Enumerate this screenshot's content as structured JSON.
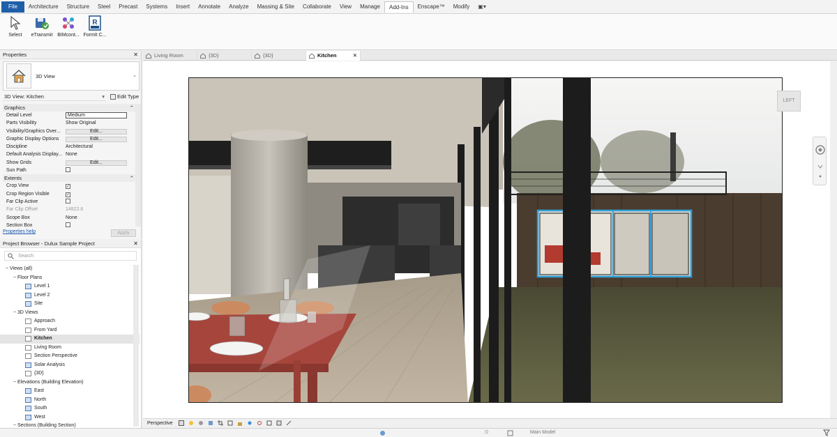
{
  "ribbon": {
    "file_tab": "File",
    "tabs": [
      "Architecture",
      "Structure",
      "Steel",
      "Precast",
      "Systems",
      "Insert",
      "Annotate",
      "Analyze",
      "Massing & Site",
      "Collaborate",
      "View",
      "Manage",
      "Add-Ins",
      "Enscape™",
      "Modify"
    ],
    "active_tab": "Add-Ins",
    "buttons": [
      {
        "label": "Select",
        "icon": "cursor-icon"
      },
      {
        "label": "eTransmit",
        "icon": "etransmit-icon"
      },
      {
        "label": "BIMcont...",
        "icon": "bimcontent-icon"
      },
      {
        "label": "FormIt C...",
        "icon": "formit-icon"
      }
    ]
  },
  "properties": {
    "title": "Properties",
    "type_name": "3D View",
    "view_selector": "3D View: Kitchen",
    "edit_type": "Edit Type",
    "groups": [
      {
        "name": "Graphics",
        "rows": [
          {
            "k": "Detail Level",
            "v": "Medium",
            "kind": "box"
          },
          {
            "k": "Parts Visibility",
            "v": "Show Original",
            "kind": "text"
          },
          {
            "k": "Visibility/Graphics Over...",
            "v": "Edit...",
            "kind": "btn"
          },
          {
            "k": "Graphic Display Options",
            "v": "Edit...",
            "kind": "btn"
          },
          {
            "k": "Discipline",
            "v": "Architectural",
            "kind": "text"
          },
          {
            "k": "Default Analysis Display...",
            "v": "None",
            "kind": "text"
          },
          {
            "k": "Show Grids",
            "v": "Edit...",
            "kind": "btn"
          },
          {
            "k": "Sun Path",
            "v": "",
            "kind": "chk"
          }
        ]
      },
      {
        "name": "Extents",
        "rows": [
          {
            "k": "Crop View",
            "v": "",
            "kind": "chk-on"
          },
          {
            "k": "Crop Region Visible",
            "v": "",
            "kind": "chk-on"
          },
          {
            "k": "Far Clip Active",
            "v": "",
            "kind": "chk"
          },
          {
            "k": "Far Clip Offset",
            "v": "14822.6",
            "kind": "dim"
          },
          {
            "k": "Scope Box",
            "v": "None",
            "kind": "text"
          },
          {
            "k": "Section Box",
            "v": "",
            "kind": "chk"
          }
        ]
      }
    ],
    "help_link": "Properties help",
    "apply": "Apply"
  },
  "browser": {
    "title": "Project Browser - Dulux Sample Project",
    "search_placeholder": "Search",
    "tree": [
      {
        "label": "Views (all)",
        "level": 0,
        "twisty": "−",
        "icon": "none"
      },
      {
        "label": "Floor Plans",
        "level": 1,
        "twisty": "−",
        "icon": "none"
      },
      {
        "label": "Level 1",
        "level": 2,
        "twisty": "",
        "icon": "view"
      },
      {
        "label": "Level 2",
        "level": 2,
        "twisty": "",
        "icon": "view"
      },
      {
        "label": "Site",
        "level": 2,
        "twisty": "",
        "icon": "view"
      },
      {
        "label": "3D Views",
        "level": 1,
        "twisty": "−",
        "icon": "none"
      },
      {
        "label": "Approach",
        "level": 2,
        "twisty": "",
        "icon": "plain"
      },
      {
        "label": "From Yard",
        "level": 2,
        "twisty": "",
        "icon": "plain"
      },
      {
        "label": "Kitchen",
        "level": 2,
        "twisty": "",
        "icon": "plain",
        "selected": true
      },
      {
        "label": "Living Room",
        "level": 2,
        "twisty": "",
        "icon": "plain"
      },
      {
        "label": "Section Perspective",
        "level": 2,
        "twisty": "",
        "icon": "plain"
      },
      {
        "label": "Solar Analysis",
        "level": 2,
        "twisty": "",
        "icon": "view"
      },
      {
        "label": "{3D}",
        "level": 2,
        "twisty": "",
        "icon": "plain"
      },
      {
        "label": "Elevations (Building Elevation)",
        "level": 1,
        "twisty": "−",
        "icon": "none"
      },
      {
        "label": "East",
        "level": 2,
        "twisty": "",
        "icon": "view"
      },
      {
        "label": "North",
        "level": 2,
        "twisty": "",
        "icon": "view"
      },
      {
        "label": "South",
        "level": 2,
        "twisty": "",
        "icon": "view"
      },
      {
        "label": "West",
        "level": 2,
        "twisty": "",
        "icon": "view"
      },
      {
        "label": "Sections (Building Section)",
        "level": 1,
        "twisty": "−",
        "icon": "none"
      }
    ]
  },
  "view_tabs": [
    {
      "label": "Living Room",
      "active": false
    },
    {
      "label": "{3D}",
      "active": false
    },
    {
      "label": "{3D}",
      "active": false
    },
    {
      "label": "Kitchen",
      "active": true
    }
  ],
  "viewcube_label": "LEFT",
  "view_control": {
    "mode": "Perspective"
  },
  "status": {
    "model": "Main Model",
    "zero": ":0"
  },
  "colors": {
    "file_tab": "#1f5fa8",
    "selection": "#2fa0d8",
    "table_red": "#a6453c"
  }
}
